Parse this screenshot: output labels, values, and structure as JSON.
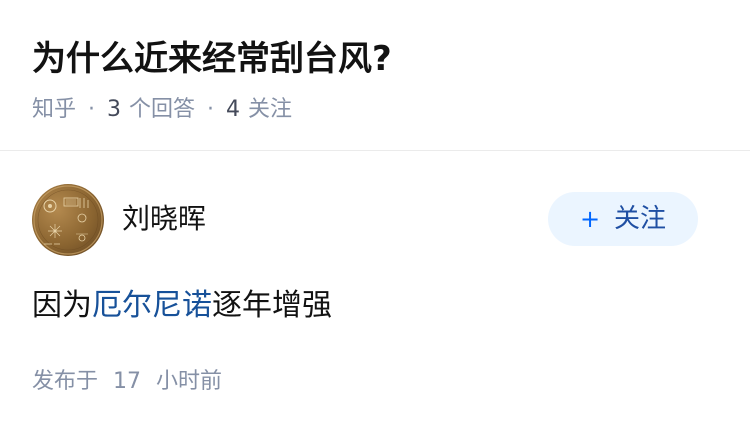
{
  "question": {
    "title": "为什么近来经常刮台风?",
    "source": "知乎",
    "answer_count": "3",
    "answer_label": "个回答",
    "follower_count": "4",
    "follower_label": "关注"
  },
  "answer": {
    "author_name": "刘晓晖",
    "follow_button": {
      "icon": "+",
      "label": "关注"
    },
    "content": {
      "prefix": "因为",
      "link_text": "厄尔尼诺",
      "suffix": "逐年增强"
    },
    "published": {
      "prefix": "发布于",
      "number": "17",
      "suffix": "小时前"
    }
  },
  "colors": {
    "link": "#175199",
    "accent": "#0066ff",
    "meta": "#8590a6",
    "follow_bg": "#ebf5ff"
  }
}
